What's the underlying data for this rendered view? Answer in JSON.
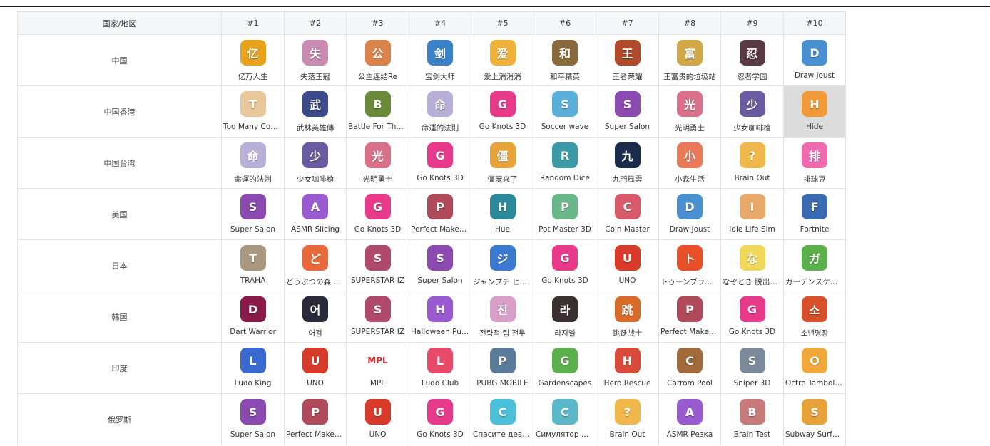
{
  "table": {
    "header": [
      "国家/地区",
      "#1",
      "#2",
      "#3",
      "#4",
      "#5",
      "#6",
      "#7",
      "#8",
      "#9",
      "#10"
    ],
    "rows": [
      {
        "region": "中国",
        "apps": [
          {
            "name": "亿万人生",
            "color": "#e8a21c",
            "glyph": "亿"
          },
          {
            "name": "失落王冠",
            "color": "#c98bb0",
            "glyph": "失"
          },
          {
            "name": "公主连结Re",
            "color": "#d9824a",
            "glyph": "公"
          },
          {
            "name": "宝剑大师",
            "color": "#3a82c8",
            "glyph": "剑"
          },
          {
            "name": "爱上消消消",
            "color": "#f2b23a",
            "glyph": "爱"
          },
          {
            "name": "和平精英",
            "color": "#8a6a3c",
            "glyph": "和"
          },
          {
            "name": "王者荣耀",
            "color": "#b04a2a",
            "glyph": "王"
          },
          {
            "name": "王富贵的垃圾站",
            "color": "#d0a848",
            "glyph": "富"
          },
          {
            "name": "忍者学园",
            "color": "#5a3a42",
            "glyph": "忍"
          },
          {
            "name": "Draw joust",
            "color": "#4a8fd0",
            "glyph": "D"
          }
        ]
      },
      {
        "region": "中国香港",
        "apps": [
          {
            "name": "Too Many Cooks",
            "color": "#e8c89a",
            "glyph": "T"
          },
          {
            "name": "武林英雄傳",
            "color": "#3a4a8a",
            "glyph": "武"
          },
          {
            "name": "Battle For The ...",
            "color": "#6a8a3a",
            "glyph": "B"
          },
          {
            "name": "命運的法則",
            "color": "#b8b0d8",
            "glyph": "命"
          },
          {
            "name": "Go Knots 3D",
            "color": "#e83a8a",
            "glyph": "G"
          },
          {
            "name": "Soccer wave",
            "color": "#5ab0d8",
            "glyph": "S"
          },
          {
            "name": "Super Salon",
            "color": "#8a4ab0",
            "glyph": "S"
          },
          {
            "name": "光明勇士",
            "color": "#d8708a",
            "glyph": "光"
          },
          {
            "name": "少女咖啡槍",
            "color": "#6a5aa0",
            "glyph": "少"
          },
          {
            "name": "Hide",
            "color": "#f09a3a",
            "glyph": "H"
          }
        ]
      },
      {
        "region": "中国台湾",
        "apps": [
          {
            "name": "命運的法則",
            "color": "#b8b0d8",
            "glyph": "命"
          },
          {
            "name": "少女咖啡槍",
            "color": "#6a5aa0",
            "glyph": "少"
          },
          {
            "name": "光明勇士",
            "color": "#d8708a",
            "glyph": "光"
          },
          {
            "name": "Go Knots 3D",
            "color": "#e83a8a",
            "glyph": "G"
          },
          {
            "name": "僵屍來了",
            "color": "#e8a23a",
            "glyph": "僵"
          },
          {
            "name": "Random Dice",
            "color": "#3a9aa8",
            "glyph": "R"
          },
          {
            "name": "九門風雲",
            "color": "#1a2a4a",
            "glyph": "九"
          },
          {
            "name": "小森生活",
            "color": "#e87a5a",
            "glyph": "小"
          },
          {
            "name": "Brain Out",
            "color": "#f0b84a",
            "glyph": "?"
          },
          {
            "name": "排球豆",
            "color": "#f06ab0",
            "glyph": "排"
          }
        ]
      },
      {
        "region": "美国",
        "apps": [
          {
            "name": "Super Salon",
            "color": "#8a4ab0",
            "glyph": "S"
          },
          {
            "name": "ASMR Slicing",
            "color": "#9a5ad0",
            "glyph": "A"
          },
          {
            "name": "Go Knots 3D",
            "color": "#e83a8a",
            "glyph": "G"
          },
          {
            "name": "Perfect Makeup ...",
            "color": "#b04a5a",
            "glyph": "P"
          },
          {
            "name": "Hue",
            "color": "#2a8a9a",
            "glyph": "H"
          },
          {
            "name": "Pot Master 3D",
            "color": "#6ab88a",
            "glyph": "P"
          },
          {
            "name": "Coin Master",
            "color": "#d85a6a",
            "glyph": "C"
          },
          {
            "name": "Draw Joust",
            "color": "#4a8fd0",
            "glyph": "D"
          },
          {
            "name": "Idle Life Sim",
            "color": "#e8a86a",
            "glyph": "I"
          },
          {
            "name": "Fortnite",
            "color": "#3a6ab0",
            "glyph": "F"
          }
        ]
      },
      {
        "region": "日本",
        "apps": [
          {
            "name": "TRAHA",
            "color": "#a89880",
            "glyph": "T"
          },
          {
            "name": "どうぶつの森 ポ...",
            "color": "#e86a3a",
            "glyph": "ど"
          },
          {
            "name": "SUPERSTAR IZ",
            "color": "#b04a6a",
            "glyph": "S"
          },
          {
            "name": "Super Salon",
            "color": "#8a4ab0",
            "glyph": "S"
          },
          {
            "name": "ジャンプチ ヒー...",
            "color": "#3a7ad0",
            "glyph": "ジ"
          },
          {
            "name": "Go Knots 3D",
            "color": "#e83a8a",
            "glyph": "G"
          },
          {
            "name": "UNO",
            "color": "#d83a2a",
            "glyph": "U"
          },
          {
            "name": "トゥーンブラスト",
            "color": "#e8502a",
            "glyph": "ト"
          },
          {
            "name": "なぞとき 脱出ゲ...",
            "color": "#f0d85a",
            "glyph": "な"
          },
          {
            "name": "ガーデンスケイプ",
            "color": "#5ab04a",
            "glyph": "ガ"
          }
        ]
      },
      {
        "region": "韩国",
        "apps": [
          {
            "name": "Dart Warrior",
            "color": "#8a1a4a",
            "glyph": "D"
          },
          {
            "name": "어검",
            "color": "#2a2a3a",
            "glyph": "어"
          },
          {
            "name": "SUPERSTAR IZ",
            "color": "#b04a6a",
            "glyph": "S"
          },
          {
            "name": "Halloween Pum...",
            "color": "#9a5ad0",
            "glyph": "H"
          },
          {
            "name": "전략적 팀 전투",
            "color": "#d8a0c8",
            "glyph": "전"
          },
          {
            "name": "라지엘",
            "color": "#3a3030",
            "glyph": "라"
          },
          {
            "name": "跳跃战士",
            "color": "#d86a2a",
            "glyph": "跳"
          },
          {
            "name": "Perfect Makeup ...",
            "color": "#b04a5a",
            "glyph": "P"
          },
          {
            "name": "Go Knots 3D",
            "color": "#e83a8a",
            "glyph": "G"
          },
          {
            "name": "소년명장",
            "color": "#d8502a",
            "glyph": "소"
          }
        ]
      },
      {
        "region": "印度",
        "apps": [
          {
            "name": "Ludo King",
            "color": "#3a6ad0",
            "glyph": "L"
          },
          {
            "name": "UNO",
            "color": "#d83a2a",
            "glyph": "U"
          },
          {
            "name": "MPL",
            "color": "#ffffff",
            "glyph": "MPL"
          },
          {
            "name": "Ludo Club",
            "color": "#e84a6a",
            "glyph": "L"
          },
          {
            "name": "PUBG MOBILE",
            "color": "#5a7a9a",
            "glyph": "P"
          },
          {
            "name": "Gardenscapes",
            "color": "#5ab04a",
            "glyph": "G"
          },
          {
            "name": "Hero Rescue",
            "color": "#d84a3a",
            "glyph": "H"
          },
          {
            "name": "Carrom Pool",
            "color": "#a06a3a",
            "glyph": "C"
          },
          {
            "name": "Sniper 3D",
            "color": "#7a8a9a",
            "glyph": "S"
          },
          {
            "name": "Octro Tambola ...",
            "color": "#f0a83a",
            "glyph": "O"
          }
        ]
      },
      {
        "region": "俄罗斯",
        "apps": [
          {
            "name": "Super Salon",
            "color": "#8a4ab0",
            "glyph": "S"
          },
          {
            "name": "Perfect Makeup ...",
            "color": "#b04a5a",
            "glyph": "P"
          },
          {
            "name": "UNO",
            "color": "#d83a2a",
            "glyph": "U"
          },
          {
            "name": "Go Knots 3D",
            "color": "#e83a8a",
            "glyph": "G"
          },
          {
            "name": "Спасите девушку",
            "color": "#4ac0d8",
            "glyph": "С"
          },
          {
            "name": "Симулятор Ма...",
            "color": "#5ab8c8",
            "glyph": "С"
          },
          {
            "name": "Brain Out",
            "color": "#f0b84a",
            "glyph": "?"
          },
          {
            "name": "ASMR Резка",
            "color": "#9a5ad0",
            "glyph": "A"
          },
          {
            "name": "Brain Test",
            "color": "#c87a7a",
            "glyph": "B"
          },
          {
            "name": "Subway Surfers",
            "color": "#e8a23a",
            "glyph": "S"
          }
        ]
      }
    ],
    "highlight": {
      "row": 1,
      "col": 9,
      "color": "#dcdcdc"
    }
  }
}
